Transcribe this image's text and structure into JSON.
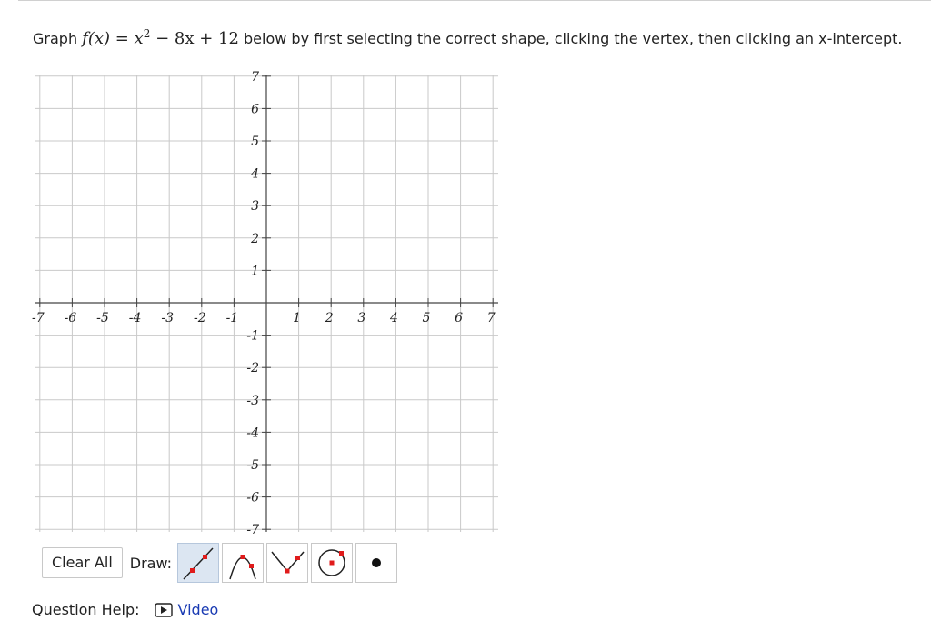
{
  "question": {
    "prefix": "Graph ",
    "func": "f(x) = x",
    "exp": "2",
    "rest": " − 8x + 12",
    "suffix": " below by first selecting the correct shape, clicking the vertex, then clicking an x-intercept."
  },
  "graph": {
    "x_range": [
      -7,
      7
    ],
    "y_range": [
      -7,
      7
    ],
    "x_tick_labels": [
      "-7",
      "-6",
      "-5",
      "-4",
      "-3",
      "-2",
      "-1",
      "1",
      "2",
      "3",
      "4",
      "5",
      "6",
      "7"
    ],
    "y_tick_labels": [
      "7",
      "6",
      "5",
      "4",
      "3",
      "2",
      "1",
      "-1",
      "-2",
      "-3",
      "-4",
      "-5",
      "-6",
      "-7"
    ],
    "grid": true
  },
  "toolbar": {
    "clear_label": "Clear All",
    "draw_label": "Draw:",
    "tools": [
      {
        "name": "line-tool",
        "icon": "line-icon",
        "active": true
      },
      {
        "name": "parabola-down-tool",
        "icon": "parabola-down-icon",
        "active": false
      },
      {
        "name": "absolute-value-tool",
        "icon": "vee-icon",
        "active": false
      },
      {
        "name": "circle-tool",
        "icon": "circle-icon",
        "active": false
      },
      {
        "name": "point-tool",
        "icon": "point-icon",
        "active": false
      }
    ],
    "accent_color": "#e01b1b"
  },
  "help": {
    "label": "Question Help:",
    "video_label": "Video",
    "link_color": "#1a3bb3"
  }
}
